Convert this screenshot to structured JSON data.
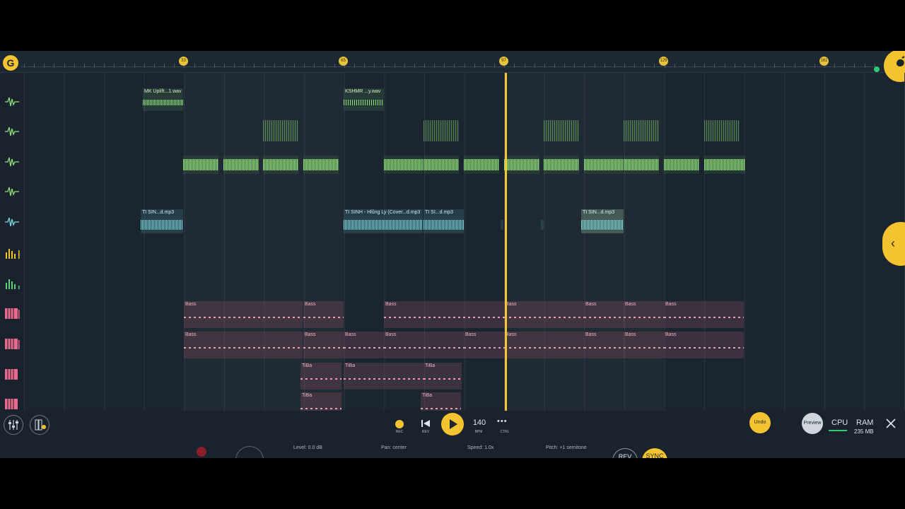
{
  "ruler": {
    "markers": [
      "33",
      "65",
      "97",
      "129",
      "161"
    ]
  },
  "clips": {
    "audio1": "MK Uplift...1.wav",
    "audio2": "KSHMR ...y.wav",
    "cyan1": "T⁠I SIN...d.mp3",
    "cyan2": "T⁠I SINH - Hlũng Ly (Cover...d.mp3",
    "cyan3": "T⁠I SI...d.mp3",
    "cyan4": "T⁠I SIN...d.mp3",
    "bass": "Bass",
    "tiba": "TiBa"
  },
  "transport": {
    "rec_label": "REC",
    "rev_label": "REV",
    "bpm_value": "140",
    "bpm_label": "BPM",
    "ctrl_label": "CTRL",
    "more_dots": "•••",
    "undo_label": "Undo",
    "preview_label": "Preview",
    "cpu_label": "CPU",
    "ram_label": "RAM",
    "ram_value": "235 MB",
    "level": "Level: 0.0 dB",
    "pan": "Pan: center",
    "speed": "Speed: 1.0x",
    "pitch": "Pitch: +1 semitone",
    "rev_btn": "REV",
    "sync_btn": "SYNC"
  },
  "colors": {
    "accent": "#f4c430",
    "audio_wave": "#8fe07a",
    "cyan_wave": "#7fd8e0",
    "piano_roll": "#e8a0b4",
    "background": "#1b2530"
  },
  "icons": [
    "logo-icon",
    "wave-icon",
    "bars-icon",
    "piano-icon",
    "mixer-icon",
    "plugin-icon",
    "play-icon",
    "skip-back-icon",
    "close-icon",
    "chevron-left-icon",
    "fruit-icon"
  ]
}
